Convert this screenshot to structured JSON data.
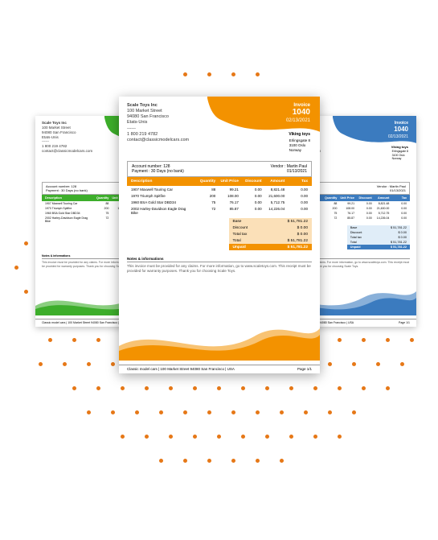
{
  "company": {
    "name": "Scale Toys Inc",
    "street": "100 Market Street",
    "city": "94080 San Francisco",
    "country": "Etats-Unis",
    "separator": "------",
    "phone": "1 800 219 4782",
    "email": "contact@classicmodelcars.com"
  },
  "invoice": {
    "title": "Invoice",
    "number": "1040",
    "date": "02/13/2021"
  },
  "client": {
    "name": "Viking toys",
    "street": "Erlingsgate 8",
    "zip": "3100 Oslo",
    "country": "Norway"
  },
  "meta": {
    "account_label": "Account number:",
    "account_value": "128",
    "payment_label": "Payment :",
    "payment_value": "30 Days (no bank)",
    "vendor_label": "Vendor :",
    "vendor_name": "Martin Paul",
    "vendor_date": "01/13/2021"
  },
  "columns": {
    "desc": "Description",
    "qty": "Quantity",
    "unit": "Unit Price",
    "disc": "Discount",
    "amt": "Amount",
    "tax": "Tax"
  },
  "lines": [
    {
      "desc": "1907 Maxwell Touring Car",
      "qty": "88",
      "unit": "99.21",
      "disc": "0.00",
      "amt": "8,821.48",
      "tax": "0.00"
    },
    {
      "desc": "1970 Triumph Spitfire",
      "qty": "200",
      "unit": "108.00",
      "disc": "0.00",
      "amt": "21,600.00",
      "tax": "0.00"
    },
    {
      "desc": "1960 BSA Gold Star DBD34",
      "qty": "75",
      "unit": "76.17",
      "disc": "0.00",
      "amt": "5,712.75",
      "tax": "0.00"
    },
    {
      "desc": "2002 Harley-Davidson Eagle Drag Bike",
      "qty": "72",
      "unit": "85.87",
      "disc": "0.00",
      "amt": "14,226.04",
      "tax": "0.00"
    }
  ],
  "totals": {
    "base_label": "Base",
    "base": "$ 51,781.22",
    "disc_label": "Discount",
    "disc": "$ 0.00",
    "taxes_label": "Total tax",
    "taxes": "$ 0.00",
    "total_label": "Total",
    "total": "$ 51,781.22",
    "unpaid_label": "Unpaid",
    "unpaid": "$ 51,781.22"
  },
  "notes": {
    "title": "Notes & informations",
    "body": "This invoice must be provided for any claims. For more information, go to www.scaletoys.com. This receipt must be provided for warranty purposes. Thank you for choosing Scale Toys."
  },
  "footer": {
    "company": "Classic model cars | 100 Market Street 94080 San Francisco | USA",
    "page": "Page 1/1"
  },
  "colors": {
    "green": "#3DAE2B",
    "orange": "#F39200",
    "blue": "#3B7BBF"
  }
}
